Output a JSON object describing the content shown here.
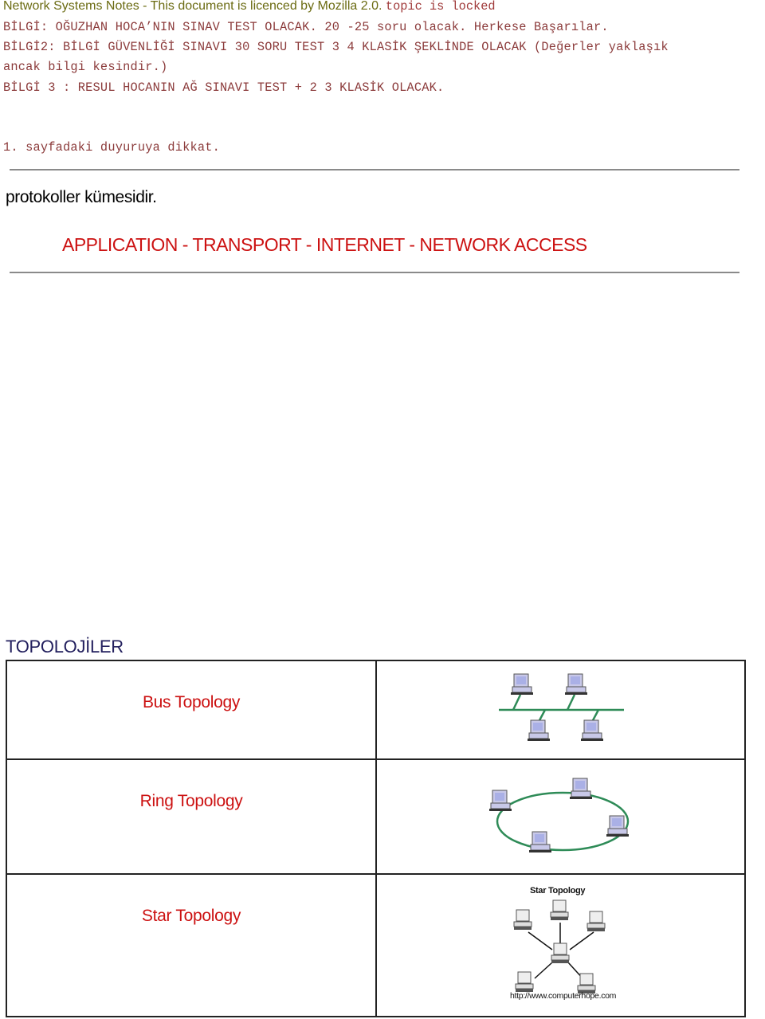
{
  "header": {
    "title": "Network Systems Notes - This document is licenced by Mozilla 2.0.",
    "status": "topic is locked"
  },
  "notes": [
    "BİLGİ: OĞUZHAN HOCA’NIN SINAV TEST OLACAK. 20 -25 soru olacak. Herkese Başarılar.",
    "BİLGİ2: BİLGİ GÜVENLİĞİ SINAVI 30 SORU TEST 3 4 KLASİK ŞEKLİNDE OLACAK (Değerler yaklaşık",
    "ancak bilgi kesindir.)",
    "BİLGİ 3 : RESUL HOCANIN AĞ SINAVI TEST + 2 3 KLASİK OLACAK."
  ],
  "notice": "1. sayfadaki duyuruya dikkat.",
  "protocol_text": "protokoller kümesidir.",
  "layers_text": "APPLICATION - TRANSPORT - INTERNET - NETWORK ACCESS",
  "topologies": {
    "heading": "TOPOLOJİLER",
    "rows": [
      {
        "name": "Bus Topology",
        "image": "bus-topology-diagram"
      },
      {
        "name": "Ring Topology",
        "image": "ring-topology-diagram"
      },
      {
        "name": "Star Topology",
        "image": "star-topology-diagram",
        "image_title": "Star Topology",
        "image_caption": "http://www.computerhope.com"
      }
    ]
  },
  "colors": {
    "header_title": "#6b6b12",
    "note_text": "#8b3a3a",
    "layers_text": "#cc1111",
    "heading": "#23205e",
    "link_line": "#2e8b57"
  }
}
